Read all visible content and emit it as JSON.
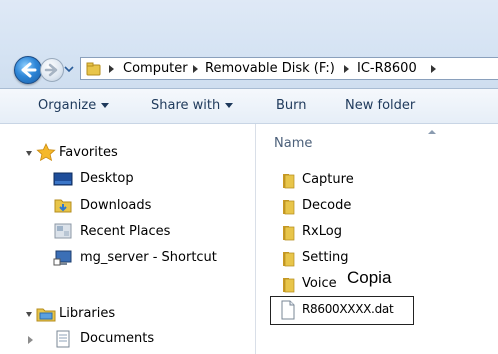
{
  "address": {
    "crumbs": [
      "Computer",
      "Removable Disk (F:)",
      "IC-R8600"
    ]
  },
  "toolbar": {
    "organize": "Organize",
    "share_with": "Share with",
    "burn": "Burn",
    "new_folder": "New folder"
  },
  "nav": {
    "favorites": "Favorites",
    "desktop": "Desktop",
    "downloads": "Downloads",
    "recent_places": "Recent Places",
    "shortcut": "mg_server - Shortcut",
    "libraries": "Libraries",
    "documents": "Documents"
  },
  "content": {
    "column_header": "Name",
    "folders": [
      "Capture",
      "Decode",
      "RxLog",
      "Setting",
      "Voice"
    ],
    "file": "R8600XXXX.dat",
    "annotation": "Copia"
  },
  "colors": {
    "folder": "#e8c54a",
    "accent": "#2f87d8",
    "command_text": "#1e395b"
  }
}
